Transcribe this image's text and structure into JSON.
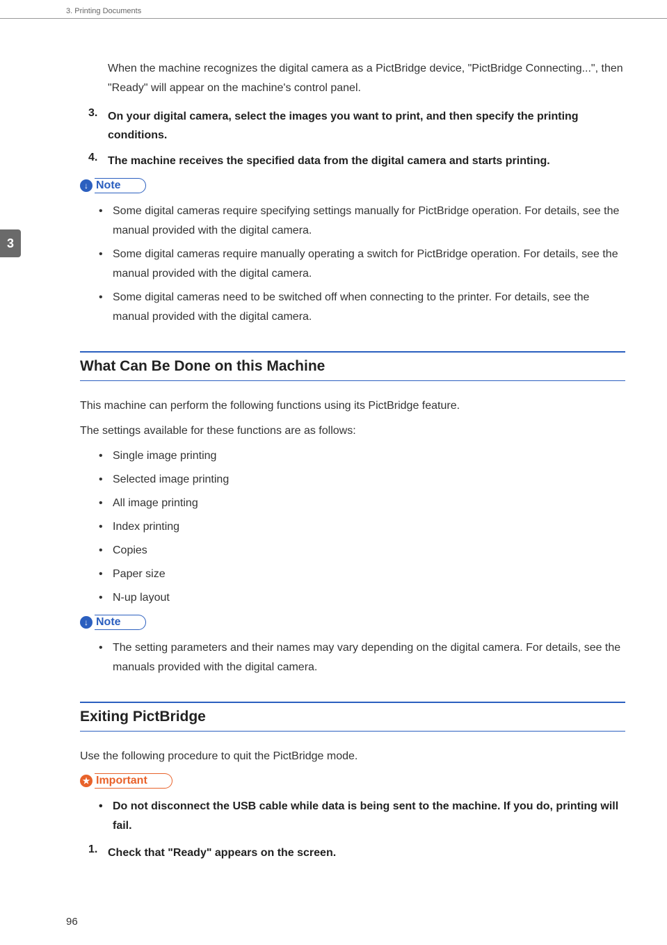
{
  "header": {
    "chapter": "3. Printing Documents"
  },
  "sideTab": "3",
  "intro": {
    "para1": "When the machine recognizes the digital camera as a PictBridge device, \"PictBridge Connecting...\", then \"Ready\" will appear on the machine's control panel."
  },
  "steps1": [
    {
      "num": "3.",
      "text": "On your digital camera, select the images you want to print, and then specify the printing conditions."
    },
    {
      "num": "4.",
      "text": "The machine receives the specified data from the digital camera and starts printing."
    }
  ],
  "callouts": {
    "note": "Note",
    "important": "Important"
  },
  "noteList1": [
    "Some digital cameras require specifying settings manually for PictBridge operation. For details, see the manual provided with the digital camera.",
    "Some digital cameras require manually operating a switch for PictBridge operation. For details, see the manual provided with the digital camera.",
    "Some digital cameras need to be switched off when connecting to the printer. For details, see the manual provided with the digital camera."
  ],
  "section1": {
    "heading": "What Can Be Done on this Machine",
    "para1": "This machine can perform the following functions using its PictBridge feature.",
    "para2": "The settings available for these functions are as follows:",
    "features": [
      "Single image printing",
      "Selected image printing",
      "All image printing",
      "Index printing",
      "Copies",
      "Paper size",
      "N-up layout"
    ],
    "noteList": [
      "The setting parameters and their names may vary depending on the digital camera. For details, see the manuals provided with the digital camera."
    ]
  },
  "section2": {
    "heading": "Exiting PictBridge",
    "para1": "Use the following procedure to quit the PictBridge mode.",
    "importantList": [
      "Do not disconnect the USB cable while data is being sent to the machine. If you do, printing will fail."
    ],
    "steps": [
      {
        "num": "1.",
        "text": "Check that \"Ready\" appears on the screen."
      }
    ]
  },
  "pageNumber": "96"
}
